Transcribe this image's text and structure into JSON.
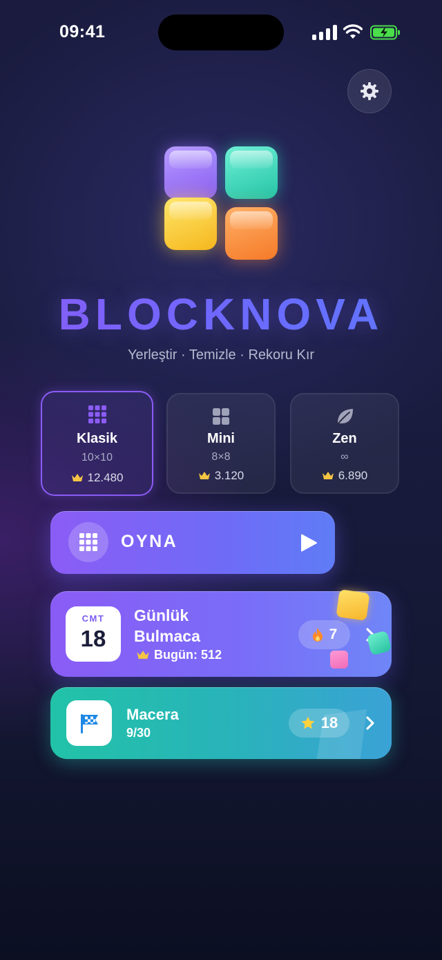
{
  "status_bar": {
    "time": "09:41"
  },
  "header": {
    "settings_icon": "gear-icon"
  },
  "brand": {
    "title": "BLOCKNOVA",
    "tagline": "Yerleştir · Temizle · Rekoru Kır",
    "logo_colors": [
      "#9f7bff",
      "#3edcc0",
      "#ffd23c",
      "#ff8d3a"
    ]
  },
  "modes": [
    {
      "name": "Klasik",
      "size": "10×10",
      "score": "12.480",
      "icon": "grid-3x3-icon",
      "selected": true
    },
    {
      "name": "Mini",
      "size": "8×8",
      "score": "3.120",
      "icon": "grid-2x2-icon",
      "selected": false
    },
    {
      "name": "Zen",
      "size": "∞",
      "score": "6.890",
      "icon": "leaf-icon",
      "selected": false
    }
  ],
  "play": {
    "label": "OYNA",
    "icon": "grid-icon",
    "arrow_icon": "play-icon"
  },
  "daily": {
    "calendar_day": "CMT",
    "calendar_date": "18",
    "title": "Günlük Bulmaca",
    "subtitle": "Bugün: 512",
    "streak": "7",
    "streak_icon": "fire-icon"
  },
  "adventure": {
    "title": "Macera",
    "progress": "9/30",
    "stars": "18",
    "icon": "checkered-flag-icon"
  },
  "colors": {
    "accent": "#8b5cf6",
    "teal": "#22c2a8",
    "crown": "#f5c542"
  }
}
